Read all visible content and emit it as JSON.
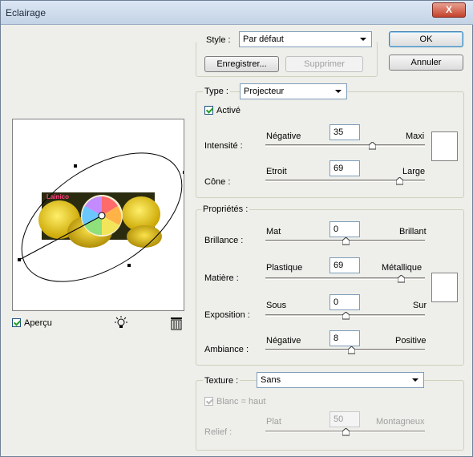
{
  "window": {
    "title": "Eclairage",
    "close_label": "X"
  },
  "style": {
    "label": "Style :",
    "value": "Par défaut",
    "save_btn": "Enregistrer...",
    "delete_btn": "Supprimer"
  },
  "buttons": {
    "ok": "OK",
    "cancel": "Annuler"
  },
  "type": {
    "label": "Type :",
    "value": "Projecteur",
    "active_label": "Activé",
    "active_checked": true
  },
  "intensite": {
    "label": "Intensité :",
    "min": "Négative",
    "max": "Maxi",
    "value": "35",
    "level": 0.67
  },
  "cone": {
    "label": "Cône :",
    "min": "Etroit",
    "max": "Large",
    "value": "69",
    "level": 0.84
  },
  "proprietes": {
    "label": "Propriétés :"
  },
  "brillance": {
    "label": "Brillance :",
    "min": "Mat",
    "max": "Brillant",
    "value": "0",
    "level": 0.5
  },
  "matiere": {
    "label": "Matière :",
    "min": "Plastique",
    "max": "Métallique",
    "value": "69",
    "level": 0.85
  },
  "exposition": {
    "label": "Exposition :",
    "min": "Sous",
    "max": "Sur",
    "value": "0",
    "level": 0.5
  },
  "ambiance": {
    "label": "Ambiance :",
    "min": "Négative",
    "max": "Positive",
    "value": "8",
    "level": 0.54
  },
  "texture": {
    "label": "Texture :",
    "value": "Sans",
    "white_high_label": "Blanc = haut",
    "white_high_checked": true
  },
  "relief": {
    "label": "Relief :",
    "min": "Plat",
    "max": "Montagneux",
    "value": "50",
    "level": 0.5
  },
  "preview": {
    "label": "Aperçu",
    "checked": true,
    "logo_text": "Lainico"
  },
  "colors": {
    "accent": "#3c7fb1",
    "title_bar": "#c3d3e6",
    "dialog_bg": "#eeeeea"
  }
}
